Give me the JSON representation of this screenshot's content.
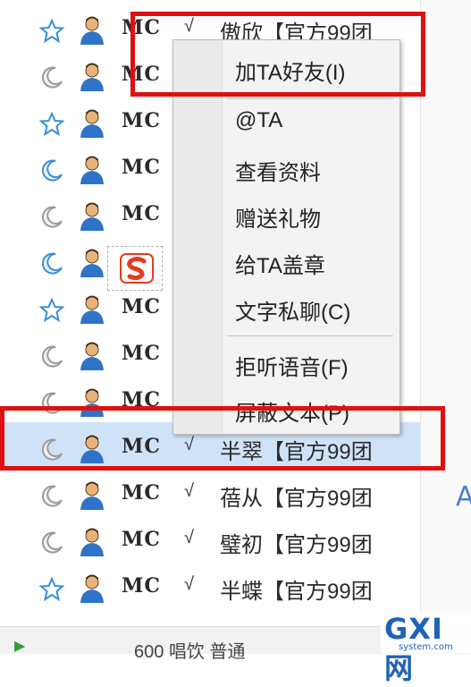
{
  "members": [
    {
      "status": "star",
      "mc": "MC",
      "check": "√",
      "name": "傲欣【官方99团"
    },
    {
      "status": "moon",
      "mc": "MC",
      "check": "",
      "name": ""
    },
    {
      "status": "star",
      "mc": "MC",
      "check": "",
      "name": ""
    },
    {
      "status": "moon-blue",
      "mc": "MC",
      "check": "",
      "name": ""
    },
    {
      "status": "moon",
      "mc": "MC",
      "check": "",
      "name": ""
    },
    {
      "status": "moon-blue",
      "mc": "",
      "check": "",
      "name": ""
    },
    {
      "status": "star",
      "mc": "MC",
      "check": "",
      "name": ""
    },
    {
      "status": "moon",
      "mc": "MC",
      "check": "",
      "name": ""
    },
    {
      "status": "moon",
      "mc": "MC",
      "check": "",
      "name": ""
    },
    {
      "status": "moon",
      "mc": "MC",
      "check": "√",
      "name": "半翠【官方99团",
      "selected": true
    },
    {
      "status": "moon",
      "mc": "MC",
      "check": "√",
      "name": "蓓从【官方99团"
    },
    {
      "status": "moon",
      "mc": "MC",
      "check": "√",
      "name": "璧初【官方99团"
    },
    {
      "status": "star",
      "mc": "MC",
      "check": "√",
      "name": "半蝶【官方99团"
    }
  ],
  "context_menu": {
    "add_friend": "加TA好友(I)",
    "at_ta": "@TA",
    "view_profile": "查看资料",
    "send_gift": "赠送礼物",
    "stamp": "给TA盖章",
    "private_chat": "文字私聊(C)",
    "reject_voice": "拒听语音(F)",
    "block_text": "屏蔽文本(P)"
  },
  "bottom_bar": {
    "text": "600 唱饮  普通"
  },
  "edge_glyph": "A",
  "watermark": {
    "logo": "GXI网",
    "sub": "system.com"
  },
  "colors": {
    "highlight": "#e01010",
    "selected_row": "#cfe3f8",
    "brand_blue": "#1f63b8"
  }
}
